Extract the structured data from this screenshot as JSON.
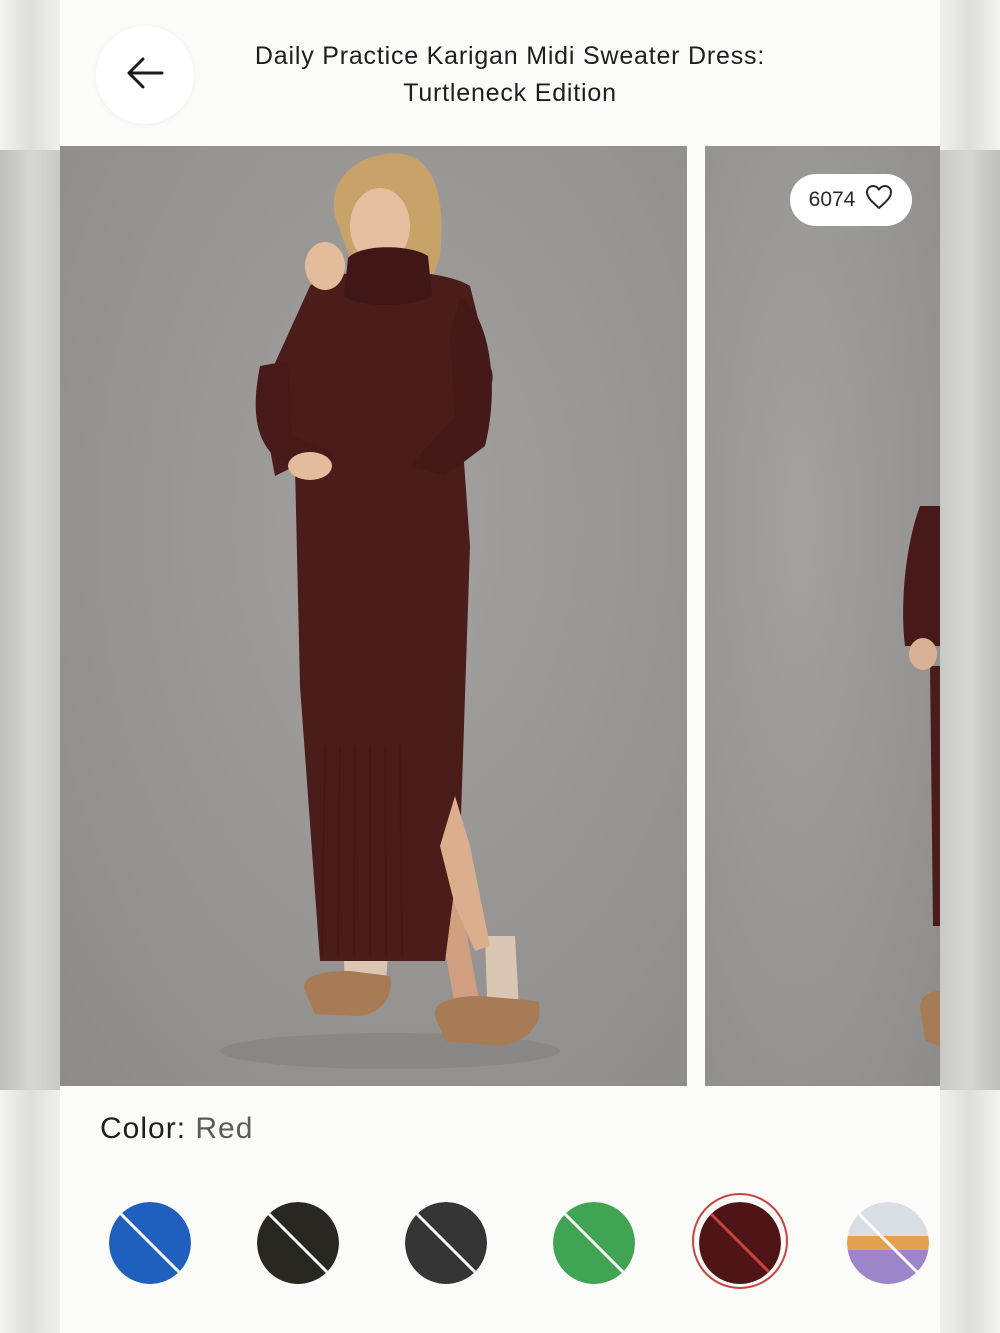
{
  "header": {
    "title_line1": "Daily Practice Karigan Midi Sweater Dress:",
    "title_line2": "Turtleneck Edition"
  },
  "gallery": {
    "likes": "6074"
  },
  "color": {
    "label": "Color:",
    "selected": "Red"
  },
  "swatches": [
    {
      "name": "blue",
      "hex": "#1f5fbe",
      "available": false,
      "selected": false
    },
    {
      "name": "black",
      "hex": "#2a2622",
      "available": false,
      "selected": false
    },
    {
      "name": "charcoal",
      "hex": "#353535",
      "available": false,
      "selected": false
    },
    {
      "name": "green",
      "hex": "#3fa552",
      "available": false,
      "selected": false
    },
    {
      "name": "red",
      "hex": "#4e1416",
      "available": false,
      "selected": true
    },
    {
      "name": "stripe",
      "hex": "#c9c9e0",
      "available": false,
      "selected": false
    }
  ],
  "colors": {
    "dress": "#4a1c1a",
    "backdrop": "#9b9997",
    "selected_ring": "#c8433f"
  }
}
